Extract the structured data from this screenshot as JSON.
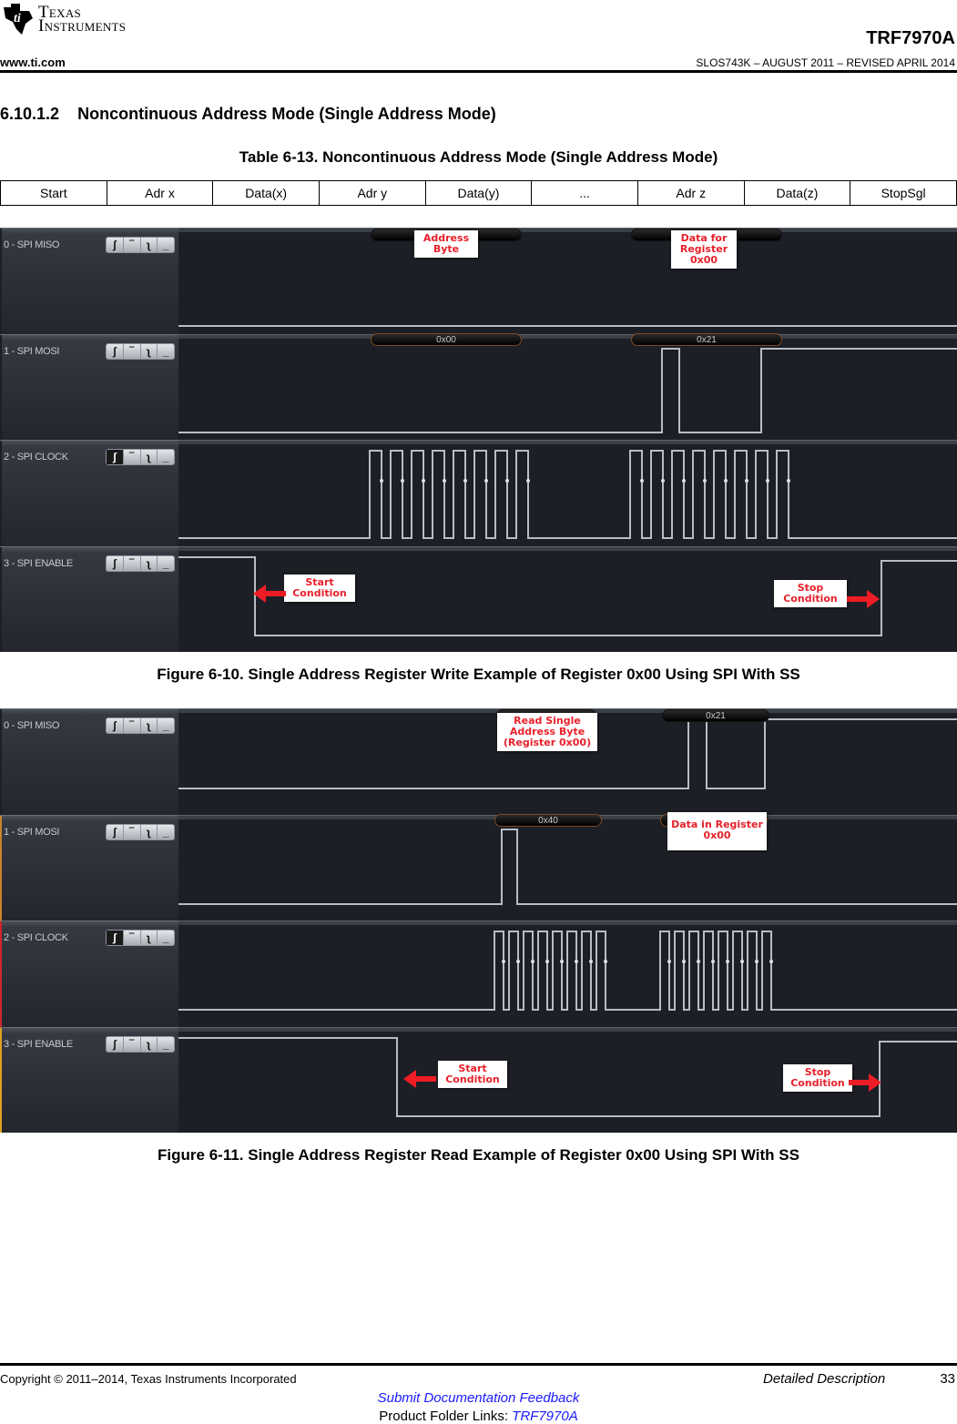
{
  "header": {
    "logo_line1": "Texas",
    "logo_line2": "Instruments",
    "part_number": "TRF7970A",
    "website": "www.ti.com",
    "doc_id": "SLOS743K – AUGUST 2011 – REVISED APRIL 2014"
  },
  "section": {
    "number": "6.10.1.2",
    "title": "Noncontinuous Address Mode (Single Address Mode)"
  },
  "table": {
    "caption": "Table 6-13. Noncontinuous Address Mode (Single Address Mode)",
    "cells": [
      "Start",
      "Adr x",
      "Data(x)",
      "Adr y",
      "Data(y)",
      "...",
      "Adr z",
      "Data(z)",
      "StopSgl"
    ]
  },
  "trigger_icons": [
    "rising-edge",
    "high",
    "falling-edge",
    "low"
  ],
  "figures": [
    {
      "caption": "Figure 6-10. Single Address Register Write Example of Register 0x00 Using SPI With SS",
      "channels": [
        {
          "name": "0 - SPI MISO",
          "accent": "#1d1f26",
          "active_trigger": null
        },
        {
          "name": "1 - SPI MOSI",
          "accent": "#1d1f26",
          "active_trigger": null
        },
        {
          "name": "2 - SPI CLOCK",
          "accent": "#1d1f26",
          "active_trigger": 0
        },
        {
          "name": "3 - SPI ENABLE",
          "accent": "#1d1f26",
          "active_trigger": null
        }
      ],
      "decoded_bytes": {
        "miso": [
          "",
          ""
        ],
        "mosi": [
          "0x00",
          "0x21"
        ]
      },
      "annotations": {
        "address_byte": "Address Byte",
        "data_for_register": "Data for Register 0x00",
        "start": "Start Condition",
        "stop": "Stop Condition"
      }
    },
    {
      "caption": "Figure 6-11. Single Address Register Read Example of Register 0x00 Using SPI With SS",
      "channels": [
        {
          "name": "0 - SPI MISO",
          "accent": "#1d1f26",
          "active_trigger": null
        },
        {
          "name": "1 - SPI MOSI",
          "accent": "#c8842a",
          "active_trigger": null
        },
        {
          "name": "2 - SPI CLOCK",
          "accent": "#d0262a",
          "active_trigger": 0
        },
        {
          "name": "3 - SPI ENABLE",
          "accent": "#e0a020",
          "active_trigger": null
        }
      ],
      "decoded_bytes": {
        "miso": [
          "",
          "0x21"
        ],
        "mosi": [
          "0x40",
          ""
        ]
      },
      "annotations": {
        "read_single": "Read Single Address Byte (Register 0x00)",
        "data_in_register": "Data in Register 0x00",
        "start": "Start Condition",
        "stop": "Stop Condition"
      }
    }
  ],
  "footer": {
    "copyright": "Copyright © 2011–2014, Texas Instruments Incorporated",
    "section_name": "Detailed Description",
    "page_number": "33",
    "feedback_link": "Submit Documentation Feedback",
    "product_links_label": "Product Folder Links: ",
    "product_link": "TRF7970A"
  }
}
